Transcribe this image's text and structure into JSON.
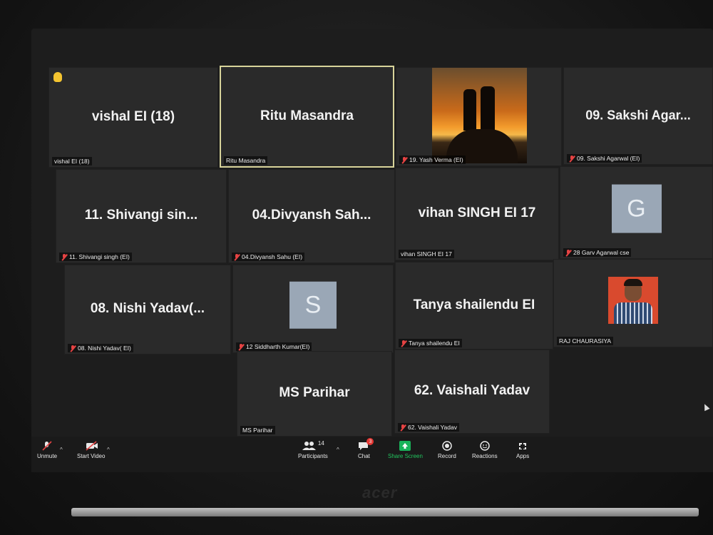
{
  "tiles": {
    "vishal": {
      "display": "vishal EI (18)",
      "label": "vishal EI (18)"
    },
    "ritu": {
      "display": "Ritu Masandra",
      "label": "Ritu Masandra"
    },
    "yash": {
      "label": "19. Yash Verma (EI)"
    },
    "sakshi": {
      "display": "09. Sakshi Agar...",
      "label": "09. Sakshi Agarwal (EI)"
    },
    "shivangi": {
      "display": "11. Shivangi sin...",
      "label": "11. Shivangi singh (EI)"
    },
    "divyansh": {
      "display": "04.Divyansh Sah...",
      "label": "04.Divyansh Sahu (EI)"
    },
    "vihan": {
      "display": "vihan SINGH EI 17",
      "label": "vihan SINGH EI 17"
    },
    "garv": {
      "avatar": "G",
      "label": "28 Garv Agarwal cse"
    },
    "nishi": {
      "display": "08. Nishi Yadav(...",
      "label": "08. Nishi Yadav( EI)"
    },
    "siddharth": {
      "avatar": "S",
      "label": "12 Siddharth Kumar(EI)"
    },
    "tanya": {
      "display": "Tanya shailendu EI",
      "label": "Tanya shailendu EI"
    },
    "raj": {
      "label": "RAJ CHAURASIYA"
    },
    "parihar": {
      "display": "MS Parihar",
      "label": "MS Parihar"
    },
    "vaishali": {
      "display": "62. Vaishali Yadav",
      "label": "62. Vaishali Yadav"
    }
  },
  "toolbar": {
    "unmute": "Unmute",
    "start_video": "Start Video",
    "participants": "Participants",
    "participants_count": "14",
    "chat": "Chat",
    "chat_badge": "3",
    "share_screen": "Share Screen",
    "record": "Record",
    "reactions": "Reactions",
    "apps": "Apps"
  },
  "laptop_brand": "acer",
  "colors": {
    "tile_bg": "#2a2a2a",
    "active_speaker_border": "#d8d49a",
    "share_green": "#19b35a",
    "muted_red": "#e64343"
  }
}
